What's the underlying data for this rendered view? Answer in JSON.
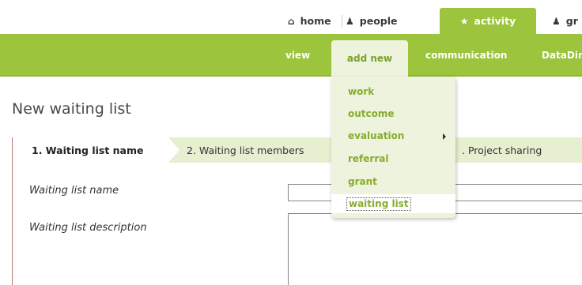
{
  "topnav": {
    "items": [
      {
        "label": "home",
        "icon": "home-icon"
      },
      {
        "label": "people",
        "icon": "person-icon"
      },
      {
        "label": "activity",
        "icon": "star-icon",
        "active": true
      },
      {
        "label": "gr",
        "icon": "group-icon"
      }
    ]
  },
  "subnav": {
    "items": [
      {
        "label": "view"
      },
      {
        "label": "add new",
        "active": true
      },
      {
        "label": "communication"
      },
      {
        "label": "DataDir"
      }
    ]
  },
  "dropdown": {
    "items": [
      {
        "label": "work"
      },
      {
        "label": "outcome"
      },
      {
        "label": "evaluation",
        "has_submenu": true
      },
      {
        "label": "referral"
      },
      {
        "label": "grant"
      },
      {
        "label": "waiting list",
        "focused": true
      }
    ]
  },
  "page": {
    "title": "New waiting list"
  },
  "steps": [
    {
      "label": "1. Waiting list name",
      "active": true
    },
    {
      "label": "2. Waiting list members"
    },
    {
      "label": ". Project sharing"
    }
  ],
  "form": {
    "name_label": "Waiting list name",
    "name_value": "",
    "description_label": "Waiting list description",
    "description_value": ""
  },
  "colors": {
    "accent_green": "#9cc43c",
    "menu_bg": "#edf3dc",
    "menu_text": "#86ad2e"
  }
}
